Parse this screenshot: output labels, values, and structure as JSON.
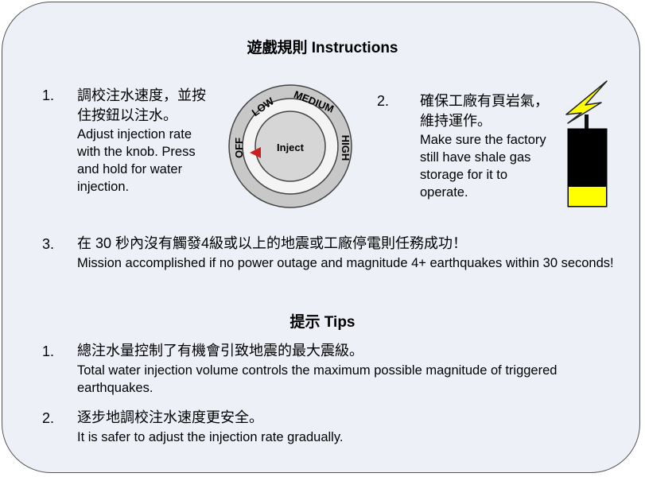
{
  "title": "遊戲規則 Instructions",
  "rules": [
    {
      "num": "1.",
      "zh": "調校注水速度，並按住按鈕以注水。",
      "en": "Adjust injection rate with the knob. Press and hold for water injection."
    },
    {
      "num": "2.",
      "zh": "確保工廠有頁岩氣，維持運作。",
      "en": "Make sure the factory still have shale gas storage for it to operate."
    },
    {
      "num": "3.",
      "zh": "在 30 秒內沒有觸發4級或以上的地震或工廠停電則任務成功！",
      "en": "Mission accomplished if no power outage and magnitude 4+ earthquakes within 30 seconds!"
    }
  ],
  "knob": {
    "inject_label": "Inject",
    "settings": [
      "OFF",
      "LOW",
      "MEDIUM",
      "HIGH"
    ],
    "current_setting": "OFF"
  },
  "battery": {
    "fill_fraction": 0.25,
    "fill_color": "#ffff00",
    "bolt_color": "#ffff00"
  },
  "tips_title": "提示 Tips",
  "tips": [
    {
      "num": "1.",
      "zh": "總注水量控制了有機會引致地震的最大震級。",
      "en": "Total water injection volume controls the maximum possible magnitude of triggered earthquakes."
    },
    {
      "num": "2.",
      "zh": "逐步地調校注水速度更安全。",
      "en": "It is safer to adjust the injection rate gradually."
    }
  ]
}
